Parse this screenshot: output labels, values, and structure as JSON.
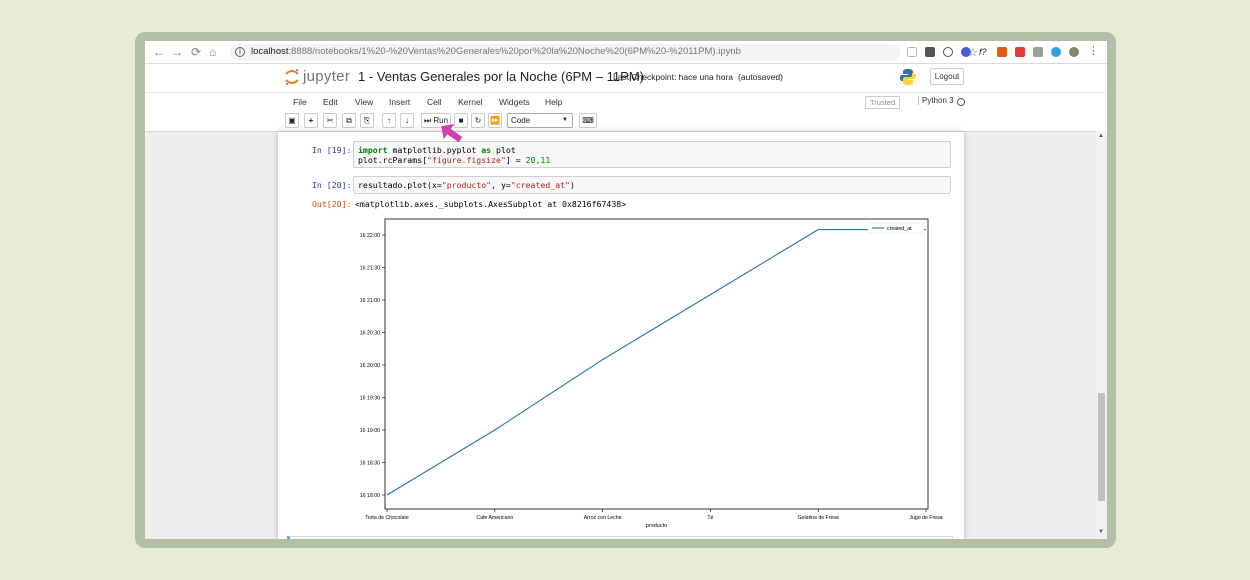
{
  "browser": {
    "url_host": "localhost",
    "url_rest": ":8888/notebooks/1%20-%20Ventas%20Generales%20por%20la%20Noche%20(6PM%20-%2011PM).ipynb",
    "icons": [
      "back-icon",
      "forward-icon",
      "reload-icon",
      "home-icon",
      "info-icon",
      "star-icon",
      "menu-dots-icon"
    ]
  },
  "header": {
    "logo_text": "jupyter",
    "title": "1 - Ventas Generales por la Noche (6PM – 11PM)",
    "checkpoint": "Last Checkpoint: hace una hora",
    "autosave": "(autosaved)",
    "logout_label": "Logout"
  },
  "menubar": {
    "items": [
      "File",
      "Edit",
      "View",
      "Insert",
      "Cell",
      "Kernel",
      "Widgets",
      "Help"
    ],
    "trusted": "Trusted",
    "kernel": "Python 3"
  },
  "toolbar": {
    "run_label": "Run",
    "celltype": "Code"
  },
  "cells": [
    {
      "prompt": "In [19]:",
      "line1": {
        "kw1": "import",
        "mid": " matplotlib.pyplot ",
        "kw2": "as",
        "end": " plot"
      },
      "line2": {
        "pre": "plot.rcParams[",
        "str": "\"figure.figsize\"",
        "post": "] = ",
        "num": "20,11"
      }
    },
    {
      "prompt": "In [20]:",
      "line1": {
        "pre": "resultado.plot(x=",
        "str1": "\"producto\"",
        "mid": ", y=",
        "str2": "\"created_at\"",
        "post": ")"
      }
    }
  ],
  "output": {
    "prompt": "Out[20]:",
    "text": "<matplotlib.axes._subplots.AxesSubplot at 0x8216f67438>"
  },
  "chart_data": {
    "type": "line",
    "categories": [
      "Torta de Chocolate",
      "Cafe Americano",
      "Arroz con Leche",
      "Té",
      "Gelatina de Fresa",
      "Jugo de Fresa"
    ],
    "series": [
      {
        "name": "created_at",
        "values": [
          "16 18:00",
          "16 19:00",
          "16 20:05",
          "16 21:05",
          "16 22:05",
          "16 22:05"
        ]
      }
    ],
    "series_minutes_after_16_18_00": [
      0,
      60,
      125,
      185,
      245,
      245
    ],
    "yticks": [
      "16 18:00",
      "16 18:30",
      "16 19:00",
      "16 19:30",
      "16 20:00",
      "16 20:30",
      "16 21:00",
      "16 21:30",
      "16 22:00"
    ],
    "xlabel": "producto",
    "ylabel": "",
    "legend": "top-right",
    "line_color": "#1f77b4"
  }
}
